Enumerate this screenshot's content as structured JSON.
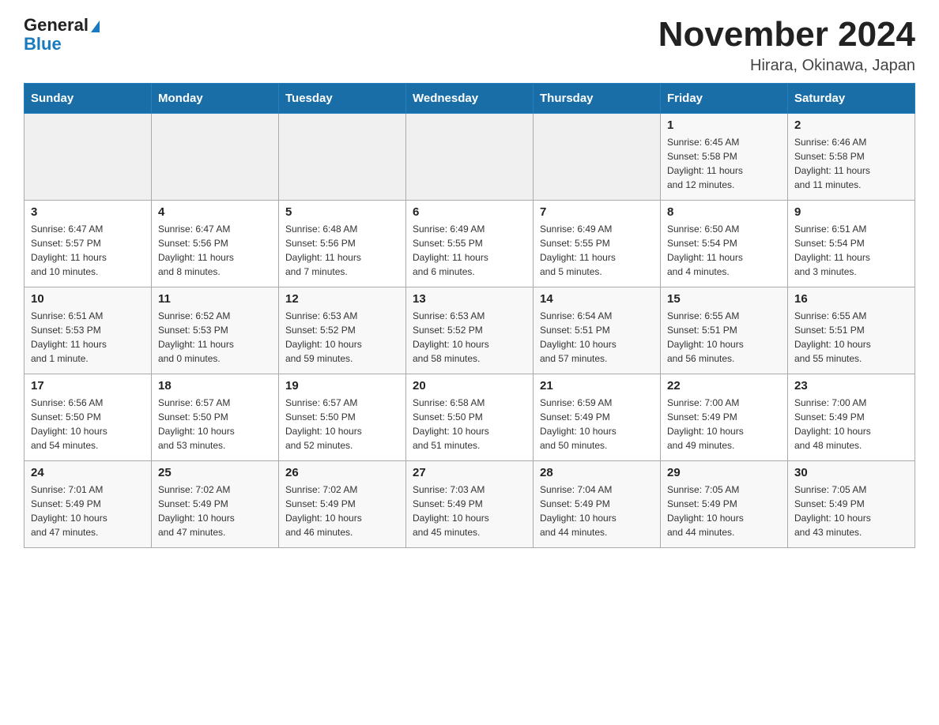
{
  "logo": {
    "general": "General",
    "blue": "Blue"
  },
  "header": {
    "month": "November 2024",
    "location": "Hirara, Okinawa, Japan"
  },
  "days_of_week": [
    "Sunday",
    "Monday",
    "Tuesday",
    "Wednesday",
    "Thursday",
    "Friday",
    "Saturday"
  ],
  "weeks": [
    [
      {
        "num": "",
        "info": ""
      },
      {
        "num": "",
        "info": ""
      },
      {
        "num": "",
        "info": ""
      },
      {
        "num": "",
        "info": ""
      },
      {
        "num": "",
        "info": ""
      },
      {
        "num": "1",
        "info": "Sunrise: 6:45 AM\nSunset: 5:58 PM\nDaylight: 11 hours\nand 12 minutes."
      },
      {
        "num": "2",
        "info": "Sunrise: 6:46 AM\nSunset: 5:58 PM\nDaylight: 11 hours\nand 11 minutes."
      }
    ],
    [
      {
        "num": "3",
        "info": "Sunrise: 6:47 AM\nSunset: 5:57 PM\nDaylight: 11 hours\nand 10 minutes."
      },
      {
        "num": "4",
        "info": "Sunrise: 6:47 AM\nSunset: 5:56 PM\nDaylight: 11 hours\nand 8 minutes."
      },
      {
        "num": "5",
        "info": "Sunrise: 6:48 AM\nSunset: 5:56 PM\nDaylight: 11 hours\nand 7 minutes."
      },
      {
        "num": "6",
        "info": "Sunrise: 6:49 AM\nSunset: 5:55 PM\nDaylight: 11 hours\nand 6 minutes."
      },
      {
        "num": "7",
        "info": "Sunrise: 6:49 AM\nSunset: 5:55 PM\nDaylight: 11 hours\nand 5 minutes."
      },
      {
        "num": "8",
        "info": "Sunrise: 6:50 AM\nSunset: 5:54 PM\nDaylight: 11 hours\nand 4 minutes."
      },
      {
        "num": "9",
        "info": "Sunrise: 6:51 AM\nSunset: 5:54 PM\nDaylight: 11 hours\nand 3 minutes."
      }
    ],
    [
      {
        "num": "10",
        "info": "Sunrise: 6:51 AM\nSunset: 5:53 PM\nDaylight: 11 hours\nand 1 minute."
      },
      {
        "num": "11",
        "info": "Sunrise: 6:52 AM\nSunset: 5:53 PM\nDaylight: 11 hours\nand 0 minutes."
      },
      {
        "num": "12",
        "info": "Sunrise: 6:53 AM\nSunset: 5:52 PM\nDaylight: 10 hours\nand 59 minutes."
      },
      {
        "num": "13",
        "info": "Sunrise: 6:53 AM\nSunset: 5:52 PM\nDaylight: 10 hours\nand 58 minutes."
      },
      {
        "num": "14",
        "info": "Sunrise: 6:54 AM\nSunset: 5:51 PM\nDaylight: 10 hours\nand 57 minutes."
      },
      {
        "num": "15",
        "info": "Sunrise: 6:55 AM\nSunset: 5:51 PM\nDaylight: 10 hours\nand 56 minutes."
      },
      {
        "num": "16",
        "info": "Sunrise: 6:55 AM\nSunset: 5:51 PM\nDaylight: 10 hours\nand 55 minutes."
      }
    ],
    [
      {
        "num": "17",
        "info": "Sunrise: 6:56 AM\nSunset: 5:50 PM\nDaylight: 10 hours\nand 54 minutes."
      },
      {
        "num": "18",
        "info": "Sunrise: 6:57 AM\nSunset: 5:50 PM\nDaylight: 10 hours\nand 53 minutes."
      },
      {
        "num": "19",
        "info": "Sunrise: 6:57 AM\nSunset: 5:50 PM\nDaylight: 10 hours\nand 52 minutes."
      },
      {
        "num": "20",
        "info": "Sunrise: 6:58 AM\nSunset: 5:50 PM\nDaylight: 10 hours\nand 51 minutes."
      },
      {
        "num": "21",
        "info": "Sunrise: 6:59 AM\nSunset: 5:49 PM\nDaylight: 10 hours\nand 50 minutes."
      },
      {
        "num": "22",
        "info": "Sunrise: 7:00 AM\nSunset: 5:49 PM\nDaylight: 10 hours\nand 49 minutes."
      },
      {
        "num": "23",
        "info": "Sunrise: 7:00 AM\nSunset: 5:49 PM\nDaylight: 10 hours\nand 48 minutes."
      }
    ],
    [
      {
        "num": "24",
        "info": "Sunrise: 7:01 AM\nSunset: 5:49 PM\nDaylight: 10 hours\nand 47 minutes."
      },
      {
        "num": "25",
        "info": "Sunrise: 7:02 AM\nSunset: 5:49 PM\nDaylight: 10 hours\nand 47 minutes."
      },
      {
        "num": "26",
        "info": "Sunrise: 7:02 AM\nSunset: 5:49 PM\nDaylight: 10 hours\nand 46 minutes."
      },
      {
        "num": "27",
        "info": "Sunrise: 7:03 AM\nSunset: 5:49 PM\nDaylight: 10 hours\nand 45 minutes."
      },
      {
        "num": "28",
        "info": "Sunrise: 7:04 AM\nSunset: 5:49 PM\nDaylight: 10 hours\nand 44 minutes."
      },
      {
        "num": "29",
        "info": "Sunrise: 7:05 AM\nSunset: 5:49 PM\nDaylight: 10 hours\nand 44 minutes."
      },
      {
        "num": "30",
        "info": "Sunrise: 7:05 AM\nSunset: 5:49 PM\nDaylight: 10 hours\nand 43 minutes."
      }
    ]
  ]
}
